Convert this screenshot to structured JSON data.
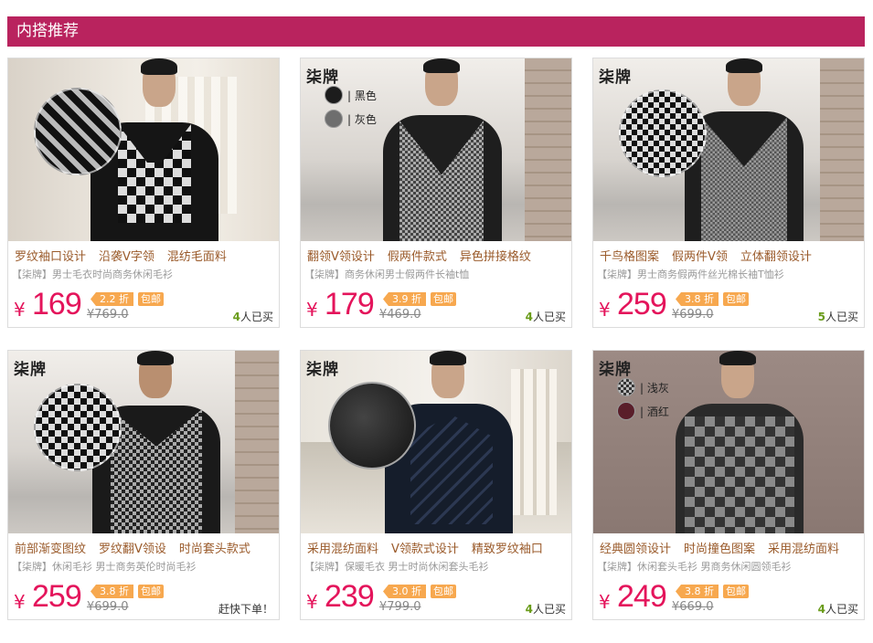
{
  "section_title": "内搭推荐",
  "brand": "柒牌",
  "currency": "¥",
  "products": [
    {
      "features": [
        "罗纹袖口设计",
        "沿袭V字领",
        "混纺毛面料"
      ],
      "desc": "【柒牌】男士毛衣时尚商务休闲毛衫",
      "price": "169",
      "discount": "2.2 折",
      "tag": "包邮",
      "orig": "¥769.0",
      "sold_count": "4",
      "sold_suffix": "人已买",
      "swatches": []
    },
    {
      "features": [
        "翻领V领设计",
        "假两件款式",
        "异色拼接格纹"
      ],
      "desc": "【柒牌】商务休闲男士假两件长袖t恤",
      "price": "179",
      "discount": "3.9 折",
      "tag": "包邮",
      "orig": "¥469.0",
      "sold_count": "4",
      "sold_suffix": "人已买",
      "swatches": [
        "| 黑色",
        "| 灰色"
      ]
    },
    {
      "features": [
        "千鸟格图案",
        "假两件V领",
        "立体翻领设计"
      ],
      "desc": "【柒牌】男士商务假两件丝光棉长袖T恤衫",
      "price": "259",
      "discount": "3.8 折",
      "tag": "包邮",
      "orig": "¥699.0",
      "sold_count": "5",
      "sold_suffix": "人已买",
      "swatches": []
    },
    {
      "features": [
        "前部渐变图纹",
        "罗纹翻V领设",
        "时尚套头款式"
      ],
      "desc": "【柒牌】休闲毛衫 男士商务英伦时尚毛衫",
      "price": "259",
      "discount": "3.8 折",
      "tag": "包邮",
      "orig": "¥699.0",
      "sold_count": "",
      "sold_suffix": "赶快下单！",
      "swatches": []
    },
    {
      "features": [
        "采用混纺面料",
        "V领款式设计",
        "精致罗纹袖口"
      ],
      "desc": "【柒牌】保暖毛衣 男士时尚休闲套头毛衫",
      "price": "239",
      "discount": "3.0 折",
      "tag": "包邮",
      "orig": "¥799.0",
      "sold_count": "4",
      "sold_suffix": "人已买",
      "swatches": []
    },
    {
      "features": [
        "经典圆领设计",
        "时尚撞色图案",
        "采用混纺面料"
      ],
      "desc": "【柒牌】休闲套头毛衫 男商务休闲圆领毛衫",
      "price": "249",
      "discount": "3.8 折",
      "tag": "包邮",
      "orig": "¥669.0",
      "sold_count": "4",
      "sold_suffix": "人已买",
      "swatches": [
        "| 浅灰",
        "| 酒红"
      ]
    }
  ]
}
